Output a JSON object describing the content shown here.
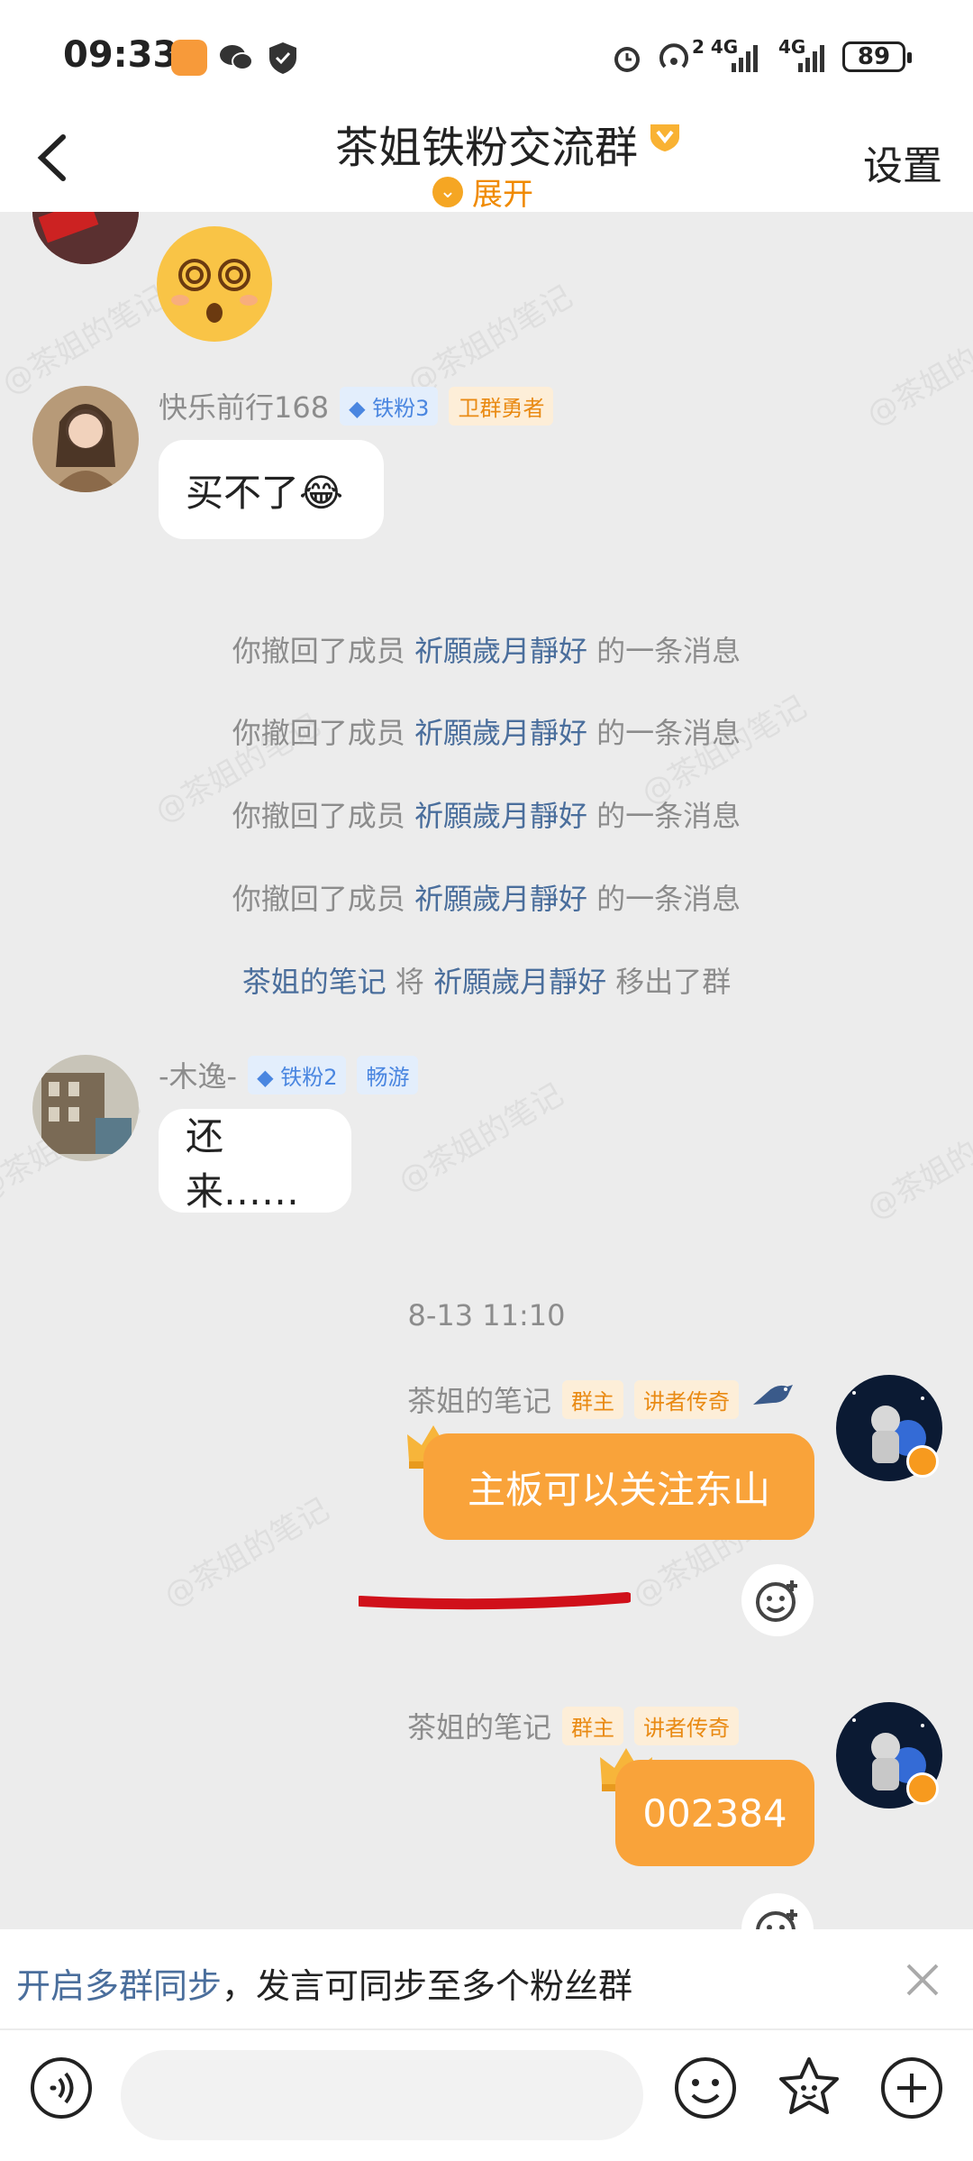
{
  "status_bar": {
    "time": "09:33",
    "network_label_1": "2 4G",
    "network_label_2": "4G",
    "battery": "89"
  },
  "header": {
    "title": "茶姐铁粉交流群",
    "expand_label": "展开",
    "settings_label": "设置"
  },
  "messages": {
    "m1": {
      "username": "快乐前行168",
      "fan_badge": "铁粉3",
      "title_badge": "卫群勇者",
      "text": "买不了😂"
    },
    "system": [
      {
        "prefix": "你撤回了成员 ",
        "link": "祈願歲月靜好",
        "suffix": " 的一条消息"
      },
      {
        "prefix": "你撤回了成员 ",
        "link": "祈願歲月靜好",
        "suffix": " 的一条消息"
      },
      {
        "prefix": "你撤回了成员 ",
        "link": "祈願歲月靜好",
        "suffix": " 的一条消息"
      },
      {
        "prefix": "你撤回了成员 ",
        "link": "祈願歲月靜好",
        "suffix": " 的一条消息"
      }
    ],
    "removed": {
      "actor": "茶姐的笔记",
      "verb": " 将 ",
      "target": "祈願歲月靜好",
      "suffix": " 移出了群"
    },
    "m2": {
      "username": "-木逸-",
      "fan_badge": "铁粉2",
      "title_badge": "畅游",
      "text": "还来……"
    },
    "timestamp": "8-13 11:10",
    "m3": {
      "username": "茶姐的笔记",
      "owner_badge": "群主",
      "title_badge": "讲者传奇",
      "text": "主板可以关注东山"
    },
    "m4": {
      "username": "茶姐的笔记",
      "owner_badge": "群主",
      "title_badge": "讲者传奇",
      "text": "002384"
    }
  },
  "watermark": "@茶姐的笔记",
  "sync_banner": {
    "link": "开启多群同步",
    "text": "，发言可同步至多个粉丝群"
  },
  "colors": {
    "accent": "#f9a33a",
    "link": "#4a6e9c",
    "background": "#ececec"
  }
}
